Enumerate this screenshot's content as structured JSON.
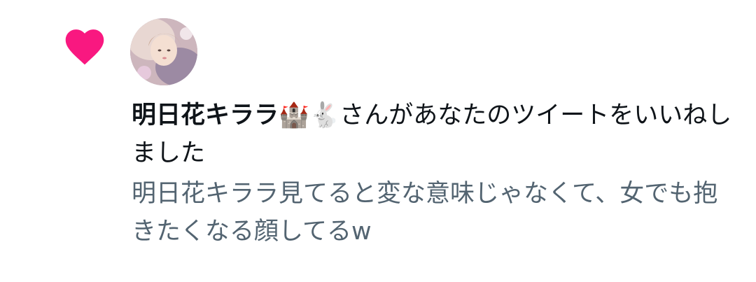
{
  "notification": {
    "type_icon": "heart-icon",
    "accent_color": "#f91880",
    "user_name": "明日花キララ",
    "user_emoji": "🏰🐇",
    "action_text": "さんがあなたのツイートをいいねしました",
    "tweet_text": "明日花キララ見てると変な意味じゃなくて、女でも抱きたくなる顔してるw"
  },
  "colors": {
    "primary_text": "#0f1419",
    "secondary_text": "#536471"
  }
}
